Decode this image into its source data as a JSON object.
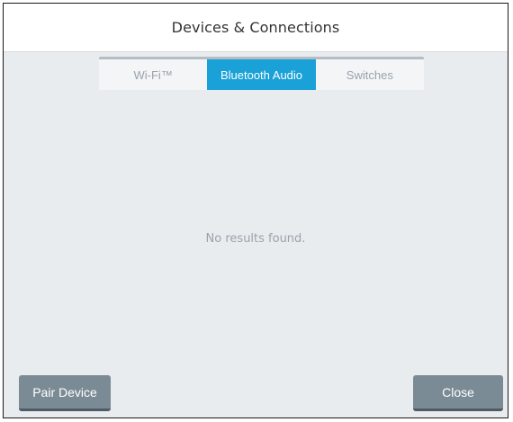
{
  "dialog": {
    "title": "Devices & Connections",
    "tabs": [
      {
        "label": "Wi-Fi™",
        "active": false
      },
      {
        "label": "Bluetooth Audio",
        "active": true
      },
      {
        "label": "Switches",
        "active": false
      }
    ],
    "empty_message": "No results found.",
    "pair_button_label": "Pair Device",
    "close_button_label": "Close"
  },
  "colors": {
    "accent": "#1aa1d8",
    "button": "#7b8b96",
    "panel_background": "#e9ecef"
  }
}
